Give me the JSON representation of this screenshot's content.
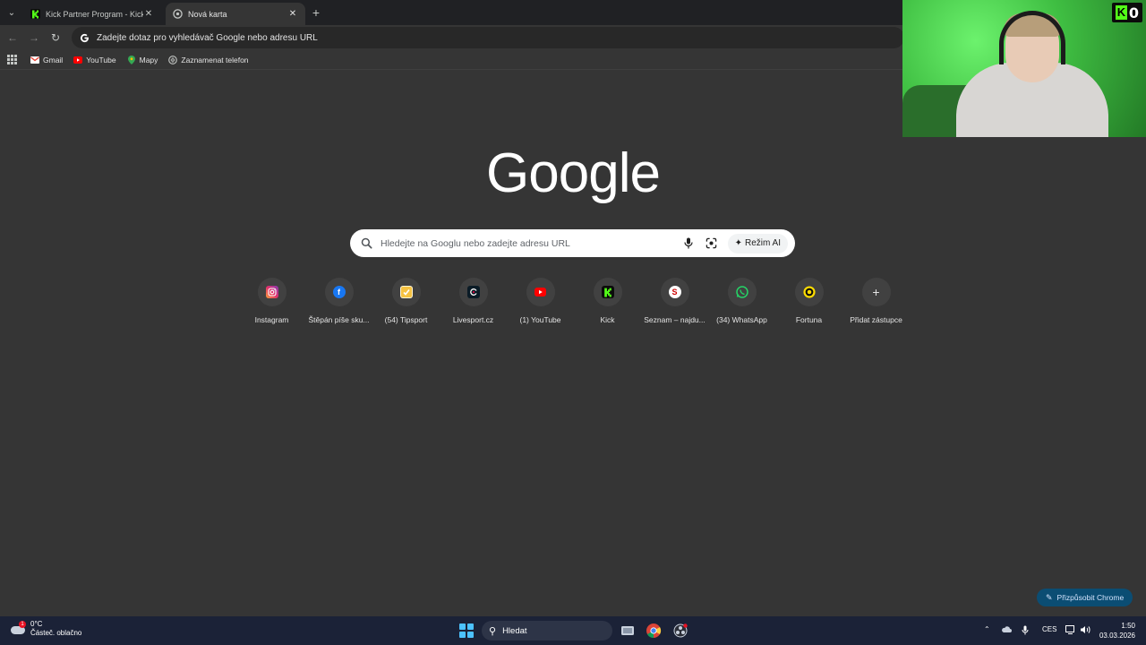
{
  "tabs": [
    {
      "title": "Kick Partner Program - Kick Dashboard",
      "active": false
    },
    {
      "title": "Nová karta",
      "active": true
    }
  ],
  "omnibox": {
    "text": "Zadejte dotaz pro vyhledávač Google nebo adresu URL"
  },
  "bookmarks": [
    {
      "label": "Gmail",
      "icon": "gmail-icon"
    },
    {
      "label": "YouTube",
      "icon": "youtube-icon"
    },
    {
      "label": "Mapy",
      "icon": "maps-icon"
    },
    {
      "label": "Zaznamenat telefon",
      "icon": "phone-record-icon"
    }
  ],
  "logo": "Google",
  "search": {
    "placeholder": "Hledejte na Googlu nebo zadejte adresu URL",
    "ai_mode_label": "Režim AI"
  },
  "shortcuts": [
    {
      "label": "Instagram",
      "icon": "instagram-icon"
    },
    {
      "label": "Štěpán píše sku...",
      "icon": "facebook-icon"
    },
    {
      "label": "(54) Tipsport",
      "icon": "tipsport-icon"
    },
    {
      "label": "Livesport.cz",
      "icon": "livesport-icon"
    },
    {
      "label": "(1) YouTube",
      "icon": "youtube-icon"
    },
    {
      "label": "Kick",
      "icon": "kick-icon"
    },
    {
      "label": "Seznam – najdu...",
      "icon": "seznam-icon"
    },
    {
      "label": "(34) WhatsApp",
      "icon": "whatsapp-icon"
    },
    {
      "label": "Fortuna",
      "icon": "fortuna-icon"
    },
    {
      "label": "Přidat zástupce",
      "icon": "plus-icon"
    }
  ],
  "webcam_badge": {
    "letter": "K",
    "count": "0"
  },
  "customize": {
    "label": "Přizpůsobit Chrome"
  },
  "taskbar": {
    "weather_temp": "0°C",
    "weather_desc": "Částeč. oblačno",
    "weather_alert": "1",
    "search_label": "Hledat",
    "lang": "CES",
    "time": "1:50",
    "date": "03.03.2026"
  }
}
